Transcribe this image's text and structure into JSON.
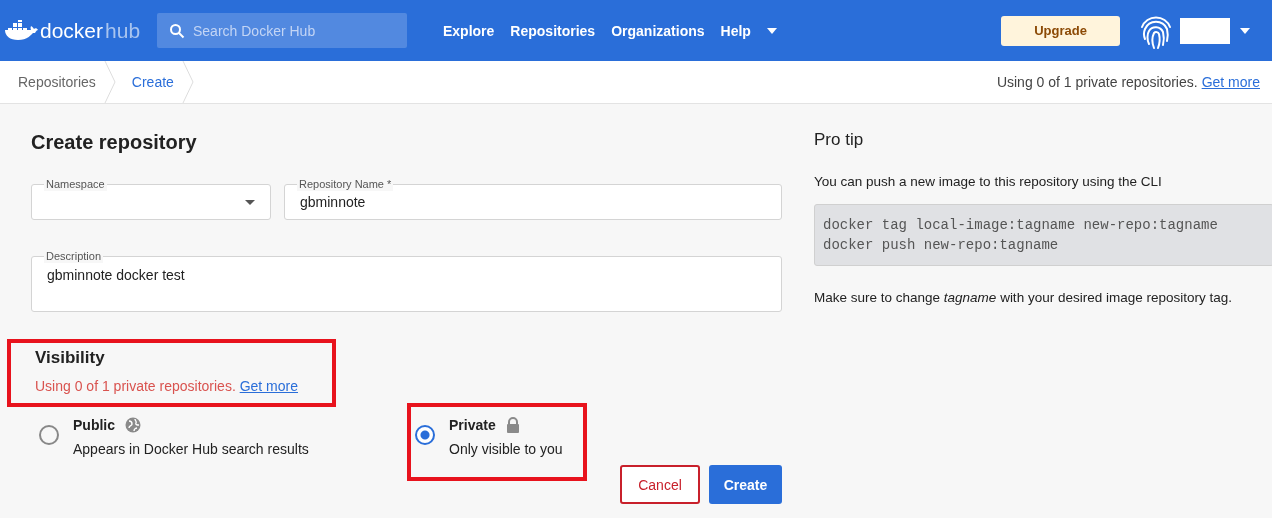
{
  "header": {
    "logo": {
      "word1": "docker",
      "word2": "hub"
    },
    "search": {
      "placeholder": "Search Docker Hub"
    },
    "nav": [
      "Explore",
      "Repositories",
      "Organizations",
      "Help"
    ],
    "upgrade": "Upgrade"
  },
  "breadcrumb": [
    {
      "label": "Repositories",
      "selected": false
    },
    {
      "label": "Create",
      "selected": true
    }
  ],
  "usage": {
    "text": "Using 0 of 1 private repositories.",
    "link": "Get more"
  },
  "form": {
    "title": "Create repository",
    "namespace": {
      "label": "Namespace"
    },
    "name": {
      "label": "Repository Name *",
      "value": "gbminnote"
    },
    "description": {
      "label": "Description",
      "value": "gbminnote docker test"
    },
    "visibility": {
      "title": "Visibility",
      "note": "Using 0 of 1 private repositories.",
      "link": "Get more",
      "highlighted": true,
      "options": [
        {
          "kind": "public",
          "label": "Public",
          "hint": "Appears in Docker Hub search results",
          "selected": false,
          "highlighted": false
        },
        {
          "kind": "private",
          "label": "Private",
          "hint": "Only visible to you",
          "selected": true,
          "highlighted": true
        }
      ]
    },
    "buttons": {
      "cancel": "Cancel",
      "create": "Create"
    }
  },
  "tip": {
    "title": "Pro tip",
    "intro": "You can push a new image to this repository using the CLI",
    "code": [
      "docker tag local-image:tagname new-repo:tagname",
      "docker push new-repo:tagname"
    ],
    "note": "Make sure to change *tagname* with your desired image repository tag."
  }
}
